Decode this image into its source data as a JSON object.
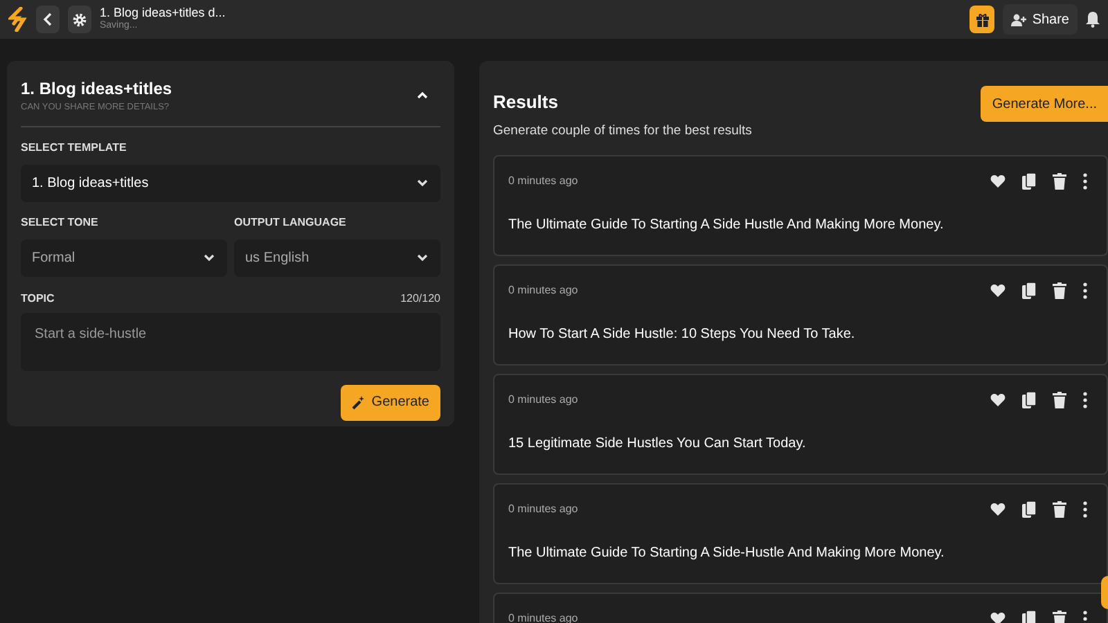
{
  "topbar": {
    "title": "1. Blog ideas+titles d...",
    "status": "Saving...",
    "share": "Share"
  },
  "form": {
    "title": "1. Blog ideas+titles",
    "subtitle": "CAN YOU SHARE MORE DETAILS?",
    "expanded": true,
    "template": {
      "label": "SELECT TEMPLATE",
      "value": "1. Blog ideas+titles"
    },
    "tone": {
      "label": "SELECT TONE",
      "value": "Formal"
    },
    "language": {
      "label": "OUTPUT LANGUAGE",
      "value": "us English"
    },
    "topic": {
      "label": "TOPIC",
      "count": "120/120",
      "placeholder": "Start a side-hustle"
    },
    "button": "Generate"
  },
  "results": {
    "title": "Results",
    "subtitle": "Generate couple of times for the best results",
    "button": "Generate More...",
    "items": [
      {
        "time": "0 minutes ago",
        "text": "The Ultimate Guide To Starting A Side Hustle And Making More Money."
      },
      {
        "time": "0 minutes ago",
        "text": "How To Start A Side Hustle: 10 Steps You Need To Take."
      },
      {
        "time": "0 minutes ago",
        "text": "15 Legitimate Side Hustles You Can Start Today."
      },
      {
        "time": "0 minutes ago",
        "text": "The Ultimate Guide To Starting A Side-Hustle And Making More Money."
      },
      {
        "time": "0 minutes ago"
      }
    ]
  }
}
